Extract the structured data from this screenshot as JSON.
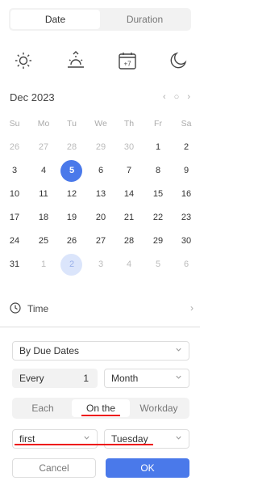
{
  "tabs": {
    "date": "Date",
    "duration": "Duration"
  },
  "quick_icons": [
    "sun-icon",
    "sunrise-icon",
    "calendar-plus7-icon",
    "moon-icon"
  ],
  "calendar_badge": "+7",
  "calendar": {
    "month_label": "Dec 2023",
    "weekdays": [
      "Su",
      "Mo",
      "Tu",
      "We",
      "Th",
      "Fr",
      "Sa"
    ],
    "weeks": [
      [
        "26",
        "27",
        "28",
        "29",
        "30",
        "1",
        "2"
      ],
      [
        "3",
        "4",
        "5",
        "6",
        "7",
        "8",
        "9"
      ],
      [
        "10",
        "11",
        "12",
        "13",
        "14",
        "15",
        "16"
      ],
      [
        "17",
        "18",
        "19",
        "20",
        "21",
        "22",
        "23"
      ],
      [
        "24",
        "25",
        "26",
        "27",
        "28",
        "29",
        "30"
      ],
      [
        "31",
        "1",
        "2",
        "3",
        "4",
        "5",
        "6"
      ]
    ],
    "selected_day": "5",
    "highlighted_next_month_day": "2"
  },
  "time": {
    "label": "Time"
  },
  "repeat": {
    "mode": "By Due Dates",
    "every_label": "Every",
    "interval": "1",
    "unit": "Month",
    "segments": [
      "Each",
      "On the",
      "Workday"
    ],
    "active_segment": "On the",
    "ordinal": "first",
    "weekday": "Tuesday"
  },
  "buttons": {
    "cancel": "Cancel",
    "ok": "OK"
  },
  "colors": {
    "accent": "#4a79ea",
    "annotation_red": "#ee1111"
  }
}
